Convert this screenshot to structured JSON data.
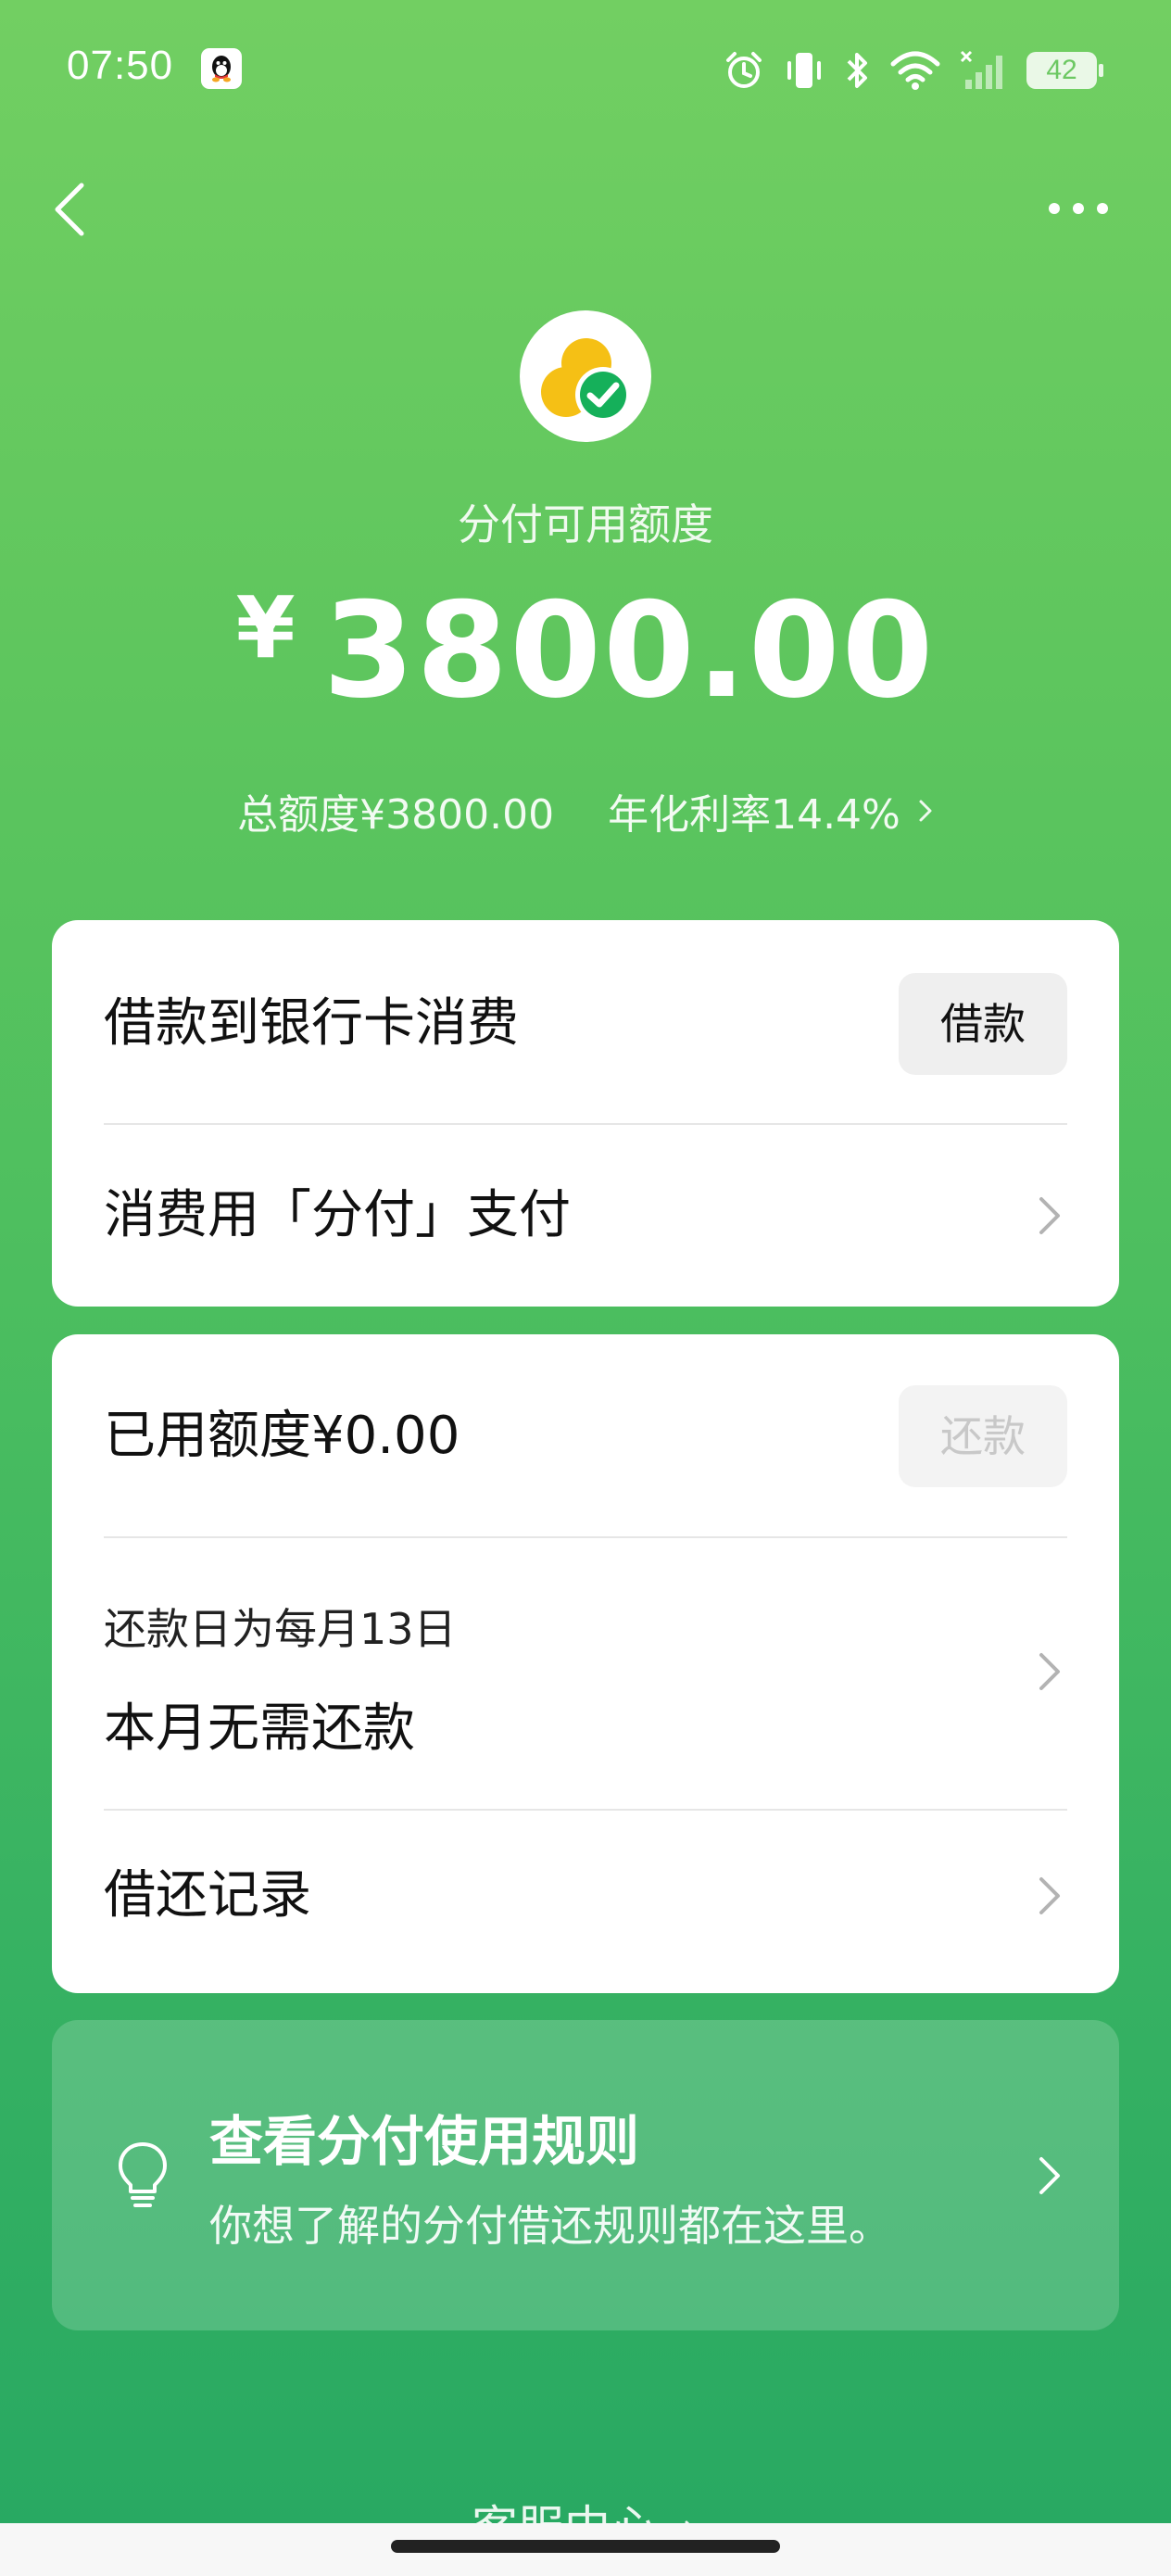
{
  "status_bar": {
    "time": "07:50",
    "battery": "42"
  },
  "header": {
    "credit_label": "分付可用额度",
    "currency": "¥",
    "available_amount": "3800.00",
    "total_credit": "总额度¥3800.00",
    "interest_rate": "年化利率14.4%"
  },
  "card1": {
    "loan_title": "借款到银行卡消费",
    "loan_button": "借款",
    "pay_title": "消费用「分付」支付"
  },
  "card2": {
    "used_credit": "已用额度¥0.00",
    "repay_button": "还款",
    "repay_day": "还款日为每月13日",
    "repay_status": "本月无需还款",
    "records": "借还记录"
  },
  "rules": {
    "title": "查看分付使用规则",
    "desc": "你想了解的分付借还规则都在这里。"
  },
  "footer": {
    "service_center": "客服中心"
  },
  "colors": {
    "brand_green": "#4cbe5f",
    "logo_yellow": "#f5c015",
    "logo_green": "#15b05a"
  }
}
